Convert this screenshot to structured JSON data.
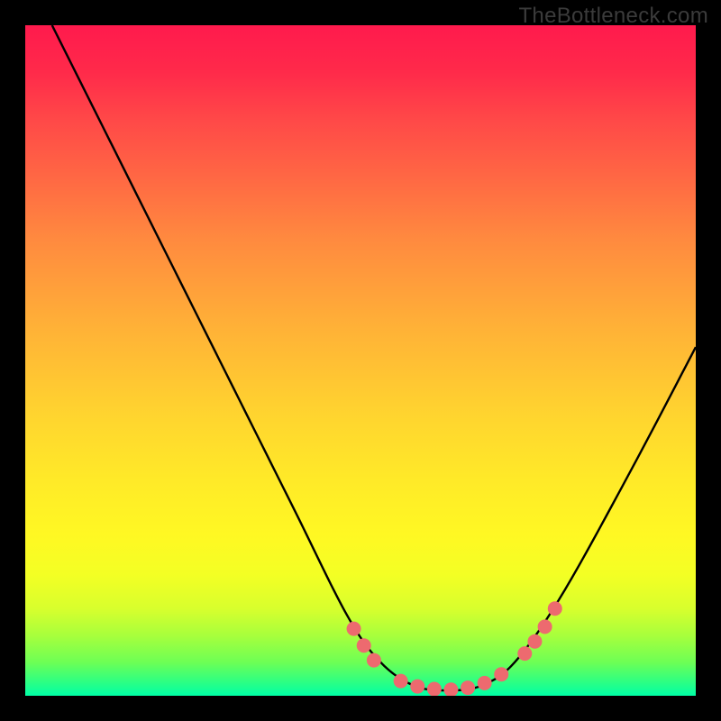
{
  "watermark": "TheBottleneck.com",
  "chart_data": {
    "type": "line",
    "title": "",
    "xlabel": "",
    "ylabel": "",
    "xlim": [
      0,
      100
    ],
    "ylim": [
      0,
      100
    ],
    "grid": false,
    "curve": {
      "name": "bottleneck-curve",
      "color": "#000000",
      "points": [
        {
          "x": 4,
          "y": 100
        },
        {
          "x": 10,
          "y": 88
        },
        {
          "x": 20,
          "y": 68
        },
        {
          "x": 30,
          "y": 48
        },
        {
          "x": 40,
          "y": 28
        },
        {
          "x": 48,
          "y": 12
        },
        {
          "x": 53,
          "y": 5
        },
        {
          "x": 58,
          "y": 1.5
        },
        {
          "x": 63,
          "y": 0.8
        },
        {
          "x": 68,
          "y": 1.5
        },
        {
          "x": 73,
          "y": 5
        },
        {
          "x": 80,
          "y": 15
        },
        {
          "x": 90,
          "y": 33
        },
        {
          "x": 100,
          "y": 52
        }
      ]
    },
    "markers": {
      "name": "data-points",
      "color": "#ed6a6f",
      "radius": 8,
      "points": [
        {
          "x": 49,
          "y": 10
        },
        {
          "x": 50.5,
          "y": 7.5
        },
        {
          "x": 52,
          "y": 5.3
        },
        {
          "x": 56,
          "y": 2.2
        },
        {
          "x": 58.5,
          "y": 1.4
        },
        {
          "x": 61,
          "y": 1.0
        },
        {
          "x": 63.5,
          "y": 0.9
        },
        {
          "x": 66,
          "y": 1.2
        },
        {
          "x": 68.5,
          "y": 1.9
        },
        {
          "x": 71,
          "y": 3.2
        },
        {
          "x": 74.5,
          "y": 6.3
        },
        {
          "x": 76,
          "y": 8.1
        },
        {
          "x": 77.5,
          "y": 10.3
        },
        {
          "x": 79,
          "y": 13
        }
      ]
    }
  }
}
